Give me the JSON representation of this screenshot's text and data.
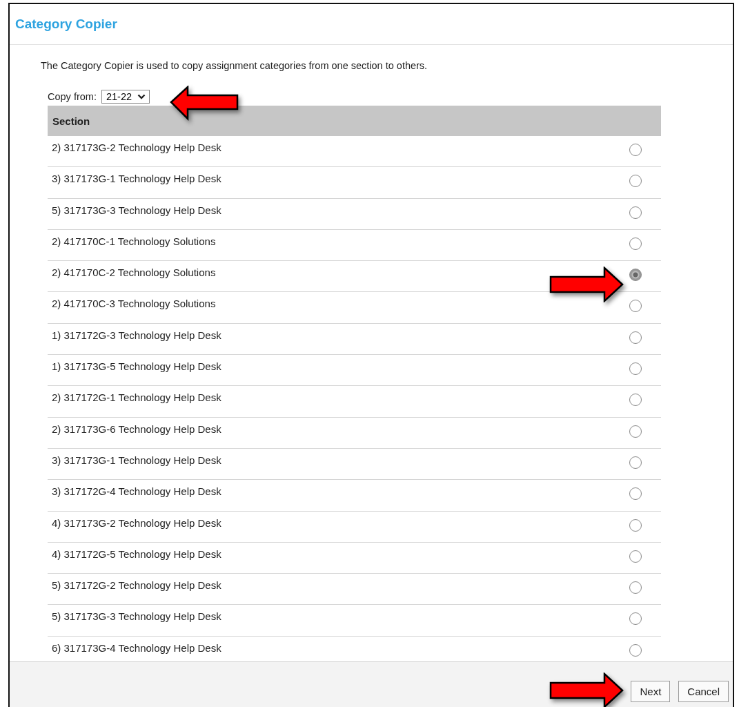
{
  "window": {
    "title": "Category Copier"
  },
  "description": "The Category Copier is used to copy assignment categories from one section to others.",
  "copy_from": {
    "label": "Copy from:",
    "value": "21-22"
  },
  "table": {
    "columns": [
      "Section"
    ],
    "rows": [
      {
        "section": "2) 317173G-2 Technology Help Desk",
        "selected": false
      },
      {
        "section": "3) 317173G-1 Technology Help Desk",
        "selected": false
      },
      {
        "section": "5) 317173G-3 Technology Help Desk",
        "selected": false
      },
      {
        "section": "2) 417170C-1 Technology Solutions",
        "selected": false
      },
      {
        "section": "2) 417170C-2 Technology Solutions",
        "selected": true
      },
      {
        "section": "2) 417170C-3 Technology Solutions",
        "selected": false
      },
      {
        "section": "1) 317172G-3 Technology Help Desk",
        "selected": false
      },
      {
        "section": "1) 317173G-5 Technology Help Desk",
        "selected": false
      },
      {
        "section": "2) 317172G-1 Technology Help Desk",
        "selected": false
      },
      {
        "section": "2) 317173G-6 Technology Help Desk",
        "selected": false
      },
      {
        "section": "3) 317173G-1 Technology Help Desk",
        "selected": false
      },
      {
        "section": "3) 317172G-4 Technology Help Desk",
        "selected": false
      },
      {
        "section": "4) 317173G-2 Technology Help Desk",
        "selected": false
      },
      {
        "section": "4) 317172G-5 Technology Help Desk",
        "selected": false
      },
      {
        "section": "5) 317172G-2 Technology Help Desk",
        "selected": false
      },
      {
        "section": "5) 317173G-3 Technology Help Desk",
        "selected": false
      },
      {
        "section": "6) 317173G-4 Technology Help Desk",
        "selected": false
      }
    ]
  },
  "buttons": [
    "Next",
    "Cancel"
  ]
}
